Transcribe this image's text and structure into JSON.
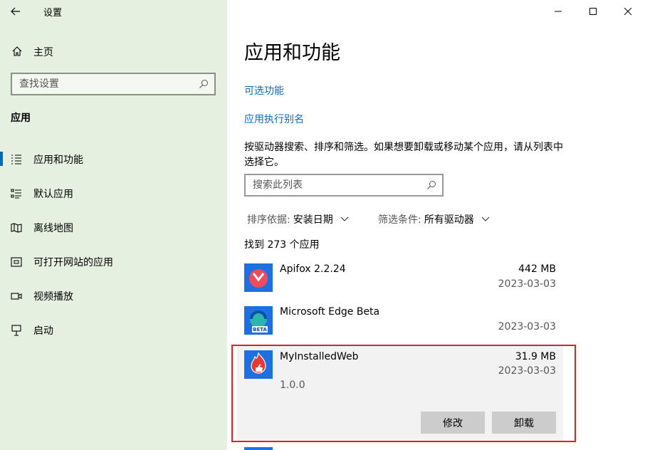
{
  "window": {
    "title": "设置",
    "controls": {
      "minimize": "minimize-icon",
      "maximize": "maximize-icon",
      "close": "close-icon"
    }
  },
  "sidebar": {
    "home": "主页",
    "search_placeholder": "查找设置",
    "section": "应用",
    "items": [
      {
        "label": "应用和功能",
        "icon": "apps-list-icon",
        "selected": true
      },
      {
        "label": "默认应用",
        "icon": "default-apps-icon",
        "selected": false
      },
      {
        "label": "离线地图",
        "icon": "offline-map-icon",
        "selected": false
      },
      {
        "label": "可打开网站的应用",
        "icon": "apps-for-websites-icon",
        "selected": false
      },
      {
        "label": "视频播放",
        "icon": "video-playback-icon",
        "selected": false
      },
      {
        "label": "启动",
        "icon": "startup-icon",
        "selected": false
      }
    ]
  },
  "main": {
    "title": "应用和功能",
    "links": [
      "可选功能",
      "应用执行别名"
    ],
    "description": "按驱动器搜索、排序和筛选。如果想要卸载或移动某个应用，请从列表中选择它。",
    "search_placeholder": "搜索此列表",
    "sort": {
      "label": "排序依据:",
      "value": "安装日期"
    },
    "filter": {
      "label": "筛选条件:",
      "value": "所有驱动器"
    },
    "count": "找到 273 个应用",
    "apps": [
      {
        "name": "Apifox 2.2.24",
        "size": "442 MB",
        "date": "2023-03-03"
      },
      {
        "name": "Microsoft Edge Beta",
        "size": "",
        "date": "2023-03-03"
      },
      {
        "name": "MyInstalledWeb",
        "size": "31.9 MB",
        "date": "2023-03-03",
        "version": "1.0.0"
      }
    ],
    "buttons": {
      "modify": "修改",
      "uninstall": "卸载"
    }
  },
  "colors": {
    "sidebar_bg": "#e6f0e1",
    "accent": "#0067c0",
    "link": "#0b6bbd",
    "highlight": "#e02020"
  }
}
